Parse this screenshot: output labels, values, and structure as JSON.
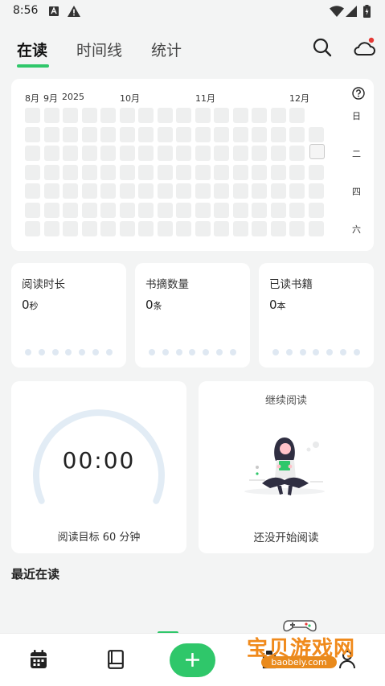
{
  "status_bar": {
    "time": "8:56"
  },
  "tabs": [
    {
      "label": "在读"
    },
    {
      "label": "时间线"
    },
    {
      "label": "统计"
    }
  ],
  "heatmap": {
    "months": [
      "8月",
      "9月",
      "2025",
      "10月",
      "11月",
      "12月"
    ],
    "day_labels": [
      "日",
      "二",
      "四",
      "六"
    ],
    "weeks": 16,
    "days": 7
  },
  "stats": [
    {
      "label": "阅读时长",
      "value": "0",
      "unit": "秒"
    },
    {
      "label": "书摘数量",
      "value": "0",
      "unit": "条"
    },
    {
      "label": "已读书籍",
      "value": "0",
      "unit": "本"
    }
  ],
  "goal": {
    "timer": "00:00",
    "text": "阅读目标 60 分钟",
    "progress": 0
  },
  "continue": {
    "title": "继续阅读",
    "empty_text": "还没开始阅读"
  },
  "recent": {
    "title": "最近在读"
  },
  "watermark": {
    "text": "宝贝游戏网",
    "url": "baobeiy.com"
  },
  "colors": {
    "accent": "#2fc76a",
    "notification": "#e53935",
    "card": "#ffffff",
    "background": "#f3f4f4"
  }
}
